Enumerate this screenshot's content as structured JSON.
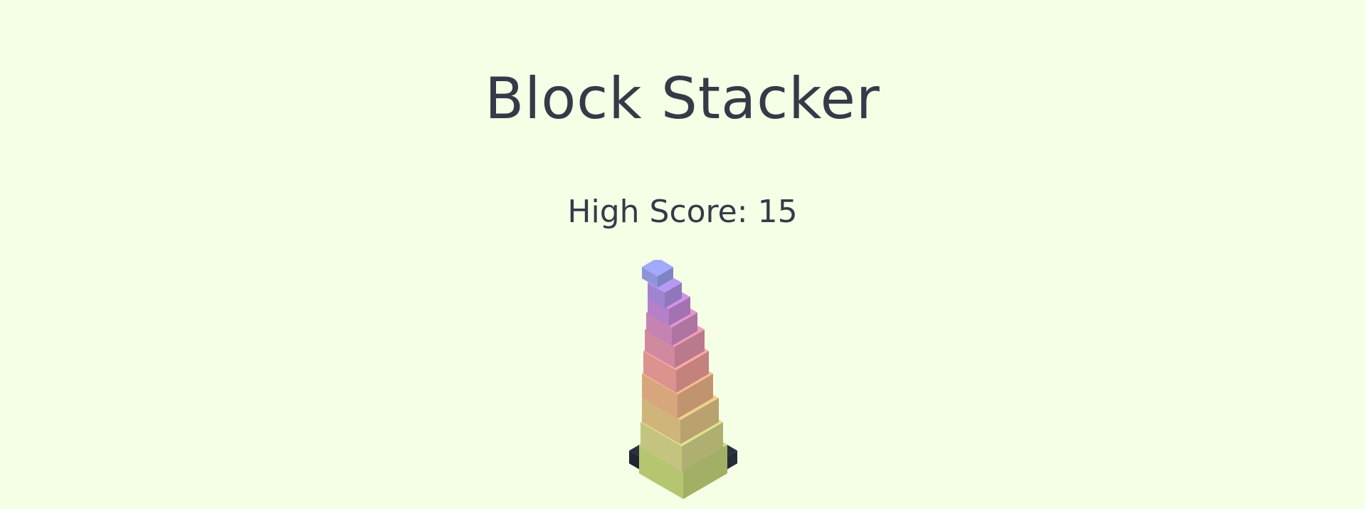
{
  "game": {
    "title": "Block Stacker",
    "high_score_label": "High Score:",
    "high_score": 15
  },
  "colors": {
    "background": "#f4ffe6",
    "text": "#353a48",
    "base": "#222733"
  },
  "tower": {
    "blocks": [
      {
        "color": "#c4d77a"
      },
      {
        "color": "#d4d58a"
      },
      {
        "color": "#e2c585"
      },
      {
        "color": "#ebb488"
      },
      {
        "color": "#ef9f9a"
      },
      {
        "color": "#e395ad"
      },
      {
        "color": "#d68ec4"
      },
      {
        "color": "#c58bd8"
      },
      {
        "color": "#ad91e3"
      },
      {
        "color": "#9aa0ee"
      }
    ]
  }
}
